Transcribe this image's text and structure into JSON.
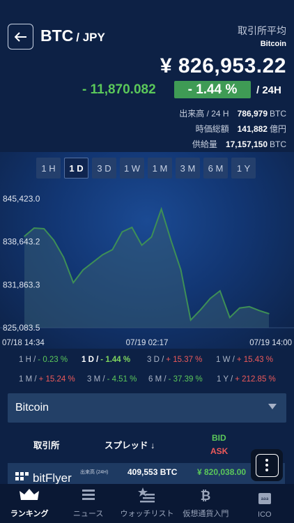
{
  "header": {
    "pair_base": "BTC",
    "pair_sep": "/ JPY",
    "exchange_label": "取引所平均",
    "coin_name": "Bitcoin",
    "price": "¥ 826,953.22",
    "change_abs": "- 11,870.082",
    "change_pct": "- 1.44 %",
    "period": "/ 24H"
  },
  "stats": [
    {
      "label": "出来高 / 24 H",
      "value": "786,979",
      "unit": "BTC"
    },
    {
      "label": "時価総額",
      "value": "141,882",
      "unit": "億円"
    },
    {
      "label": "供給量",
      "value": "17,157,150",
      "unit": "BTC"
    }
  ],
  "range_tabs": [
    {
      "label": "1 H",
      "active": false
    },
    {
      "label": "1 D",
      "active": true
    },
    {
      "label": "3 D",
      "active": false
    },
    {
      "label": "1 W",
      "active": false
    },
    {
      "label": "1 M",
      "active": false
    },
    {
      "label": "3 M",
      "active": false
    },
    {
      "label": "6 M",
      "active": false
    },
    {
      "label": "1 Y",
      "active": false
    }
  ],
  "chart_data": {
    "type": "area",
    "y_ticks": [
      "845,423.0",
      "838,643.2",
      "831,863.3",
      "825,083.5"
    ],
    "ylim": [
      825083.5,
      845423.0
    ],
    "x_ticks": [
      "07/18 14:34",
      "07/19 02:17",
      "07/19 14:00"
    ],
    "series": [
      {
        "values": [
          839500,
          840800,
          840700,
          838900,
          836200,
          832200,
          834200,
          835400,
          836600,
          837400,
          840200,
          840900,
          838100,
          839400,
          843800,
          838800,
          834200,
          826300,
          827900,
          829700,
          830900,
          826700,
          828200,
          828400,
          827800,
          827300
        ]
      }
    ],
    "colors": {
      "line": "#3e8f56",
      "fill": "#355b74"
    }
  },
  "performance": [
    {
      "period": "1 H /",
      "value": "- 0.23 %",
      "dir": "neg",
      "active": false
    },
    {
      "period": "1 D /",
      "value": "- 1.44 %",
      "dir": "neg",
      "active": true
    },
    {
      "period": "3 D /",
      "value": "+ 15.37 %",
      "dir": "pos",
      "active": false
    },
    {
      "period": "1 W /",
      "value": "+ 15.43 %",
      "dir": "pos",
      "active": false
    },
    {
      "period": "1 M /",
      "value": "+ 15.24 %",
      "dir": "pos",
      "active": false
    },
    {
      "period": "3 M /",
      "value": "- 4.51 %",
      "dir": "neg",
      "active": false
    },
    {
      "period": "6 M /",
      "value": "- 37.39 %",
      "dir": "neg",
      "active": false
    },
    {
      "period": "1 Y /",
      "value": "+ 212.85 %",
      "dir": "pos",
      "active": false
    }
  ],
  "selector": {
    "value": "Bitcoin"
  },
  "table": {
    "col_exchange": "取引所",
    "col_spread": "スプレッド ↓",
    "col_bid": "BID",
    "col_ask": "ASK",
    "row": {
      "exchange": "bitFlyer",
      "volume_label": "出来高 (24H)",
      "volume": "409,553 BTC",
      "bid": "¥ 820,038.00"
    }
  },
  "nav": [
    {
      "label": "ランキング",
      "icon": "crown-icon",
      "active": true
    },
    {
      "label": "ニュース",
      "icon": "news-icon",
      "active": false
    },
    {
      "label": "ウォッチリスト",
      "icon": "watchlist-star-icon",
      "active": false
    },
    {
      "label": "仮想通貨入門",
      "icon": "bitcoin-icon",
      "active": false
    },
    {
      "label": "ICO",
      "icon": "ico-icon",
      "active": false
    }
  ],
  "colors": {
    "background": "#0d2145",
    "positive": "#ee5a5a",
    "negative": "#5bc85a",
    "bid": "#5bc85a",
    "ask": "#ee5a5a"
  }
}
